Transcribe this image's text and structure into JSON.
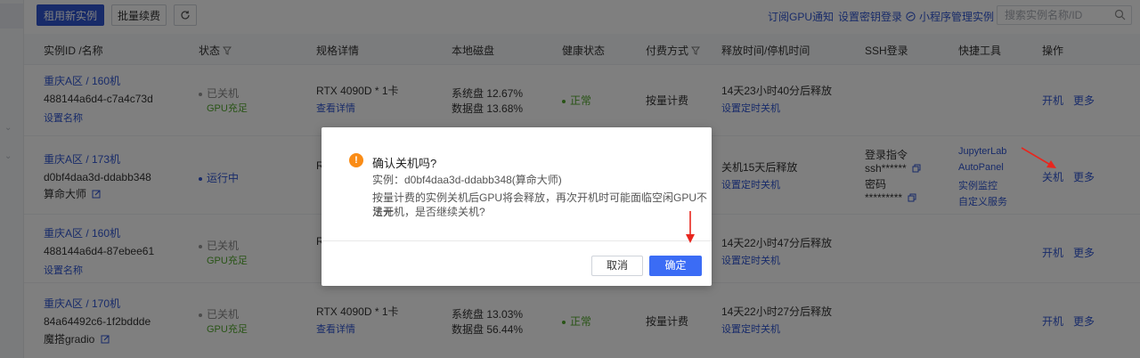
{
  "toolbar": {
    "rent_button": "租用新实例",
    "renew_button": "批量续费",
    "links": [
      "订阅GPU通知",
      "设置密钥登录",
      "小程序管理实例"
    ],
    "search_placeholder": "搜索实例名称/ID"
  },
  "table": {
    "headers": [
      "实例ID /名称",
      "状态",
      "规格详情",
      "本地磁盘",
      "健康状态",
      "付费方式",
      "释放时间/停机时间",
      "SSH登录",
      "快捷工具",
      "操作"
    ],
    "rows": [
      {
        "region": "重庆A区 / 160机",
        "id": "488144a6d4-c7a4c73d",
        "name": "设置名称",
        "status": "已关机",
        "status_sub": "GPU充足",
        "spec": "RTX 4090D * 1卡",
        "spec_link": "查看详情",
        "disk_sys": "系统盘 12.67%",
        "disk_data": "数据盘 13.68%",
        "health": "正常",
        "billing": "按量计费",
        "release": "14天23小时40分后释放",
        "release_link": "设置定时关机",
        "action1": "开机",
        "action2": "更多"
      },
      {
        "region": "重庆A区 / 173机",
        "id": "d0bf4daa3d-ddabb348",
        "name": "算命大师",
        "status": "运行中",
        "spec": "R",
        "release": "关机15天后释放",
        "release_link": "设置定时关机",
        "ssh_label": "登录指令",
        "ssh_cmd": "ssh******",
        "pwd_label": "密码",
        "pwd": "*********",
        "tools": [
          "JupyterLab",
          "AutoPanel",
          "实例监控",
          "自定义服务"
        ],
        "action1": "关机",
        "action2": "更多"
      },
      {
        "region": "重庆A区 / 160机",
        "id": "488144a6d4-87ebee61",
        "name": "设置名称",
        "status": "已关机",
        "status_sub": "GPU充足",
        "spec": "R",
        "release": "14天22小时47分后释放",
        "release_link": "设置定时关机",
        "action1": "开机",
        "action2": "更多"
      },
      {
        "region": "重庆A区 / 170机",
        "id": "84a64492c6-1f2bddde",
        "name": "魔搭gradio",
        "status": "已关机",
        "status_sub": "GPU充足",
        "spec": "RTX 4090D * 1卡",
        "spec_link": "查看详情",
        "disk_sys": "系统盘 13.03%",
        "disk_data": "数据盘 56.44%",
        "health": "正常",
        "billing": "按量计费",
        "release": "14天22小时27分后释放",
        "release_link": "设置定时关机",
        "action1": "开机",
        "action2": "更多"
      }
    ]
  },
  "modal": {
    "title": "确认关机吗?",
    "instance_line": "实例：d0bf4daa3d-ddabb348(算命大师)",
    "message_line1": "按量计费的实例关机后GPU将会释放，再次开机时可能面临空闲GPU不足无",
    "message_line2": "法开机，是否继续关机?",
    "cancel": "取消",
    "confirm": "确定"
  },
  "colors": {
    "primary": "#3056d3",
    "warning": "#fa8c16",
    "success": "#52a82c",
    "annotation_arrow": "#e8261e"
  }
}
